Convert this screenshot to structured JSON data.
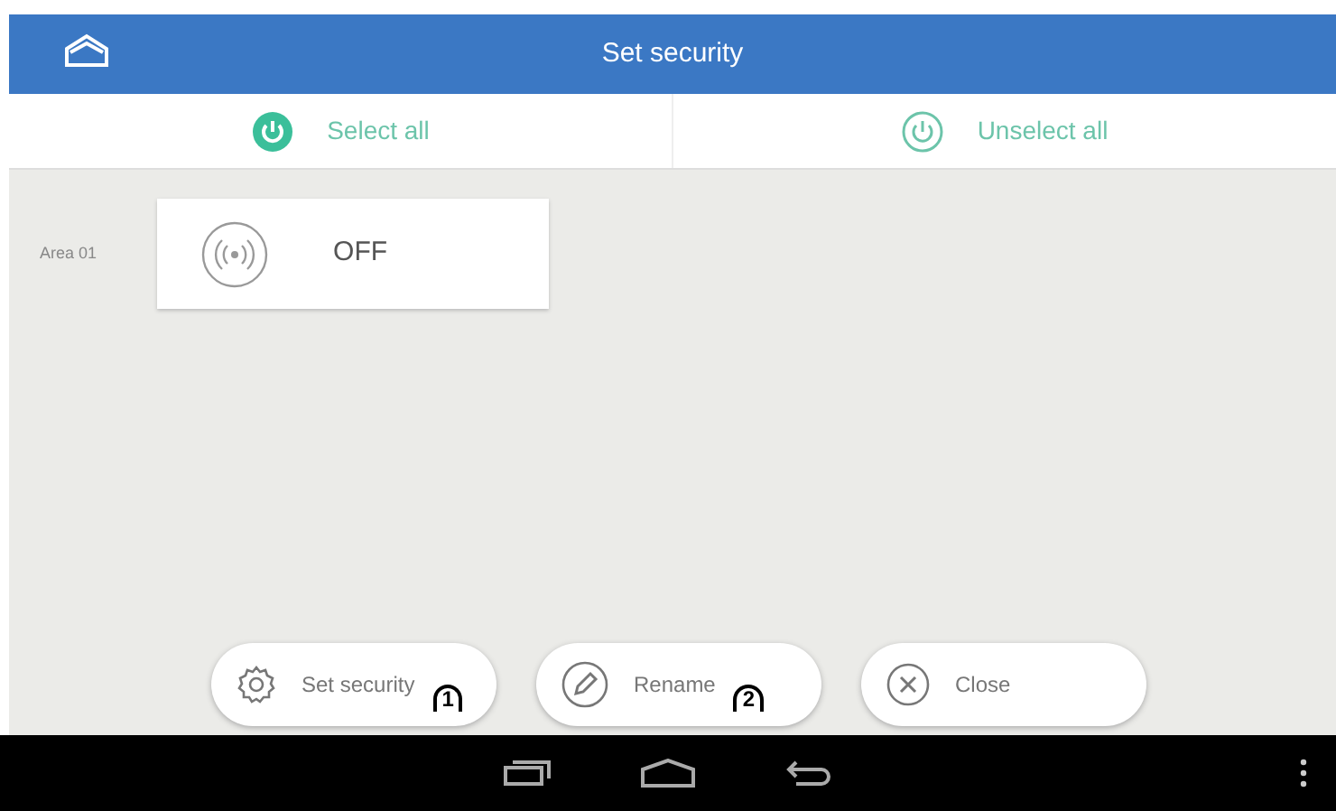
{
  "header": {
    "title": "Set security"
  },
  "toolbar": [
    {
      "label": "Select all",
      "kind": "filled"
    },
    {
      "label": "Unselect all",
      "kind": "outline"
    }
  ],
  "areas": [
    {
      "name": "Area 01",
      "status": "OFF"
    }
  ],
  "buttons": [
    {
      "label": "Set security",
      "kind": "gear",
      "callout": "1"
    },
    {
      "label": "Rename",
      "kind": "pencil",
      "callout": "2"
    },
    {
      "label": "Close",
      "kind": "close"
    }
  ]
}
